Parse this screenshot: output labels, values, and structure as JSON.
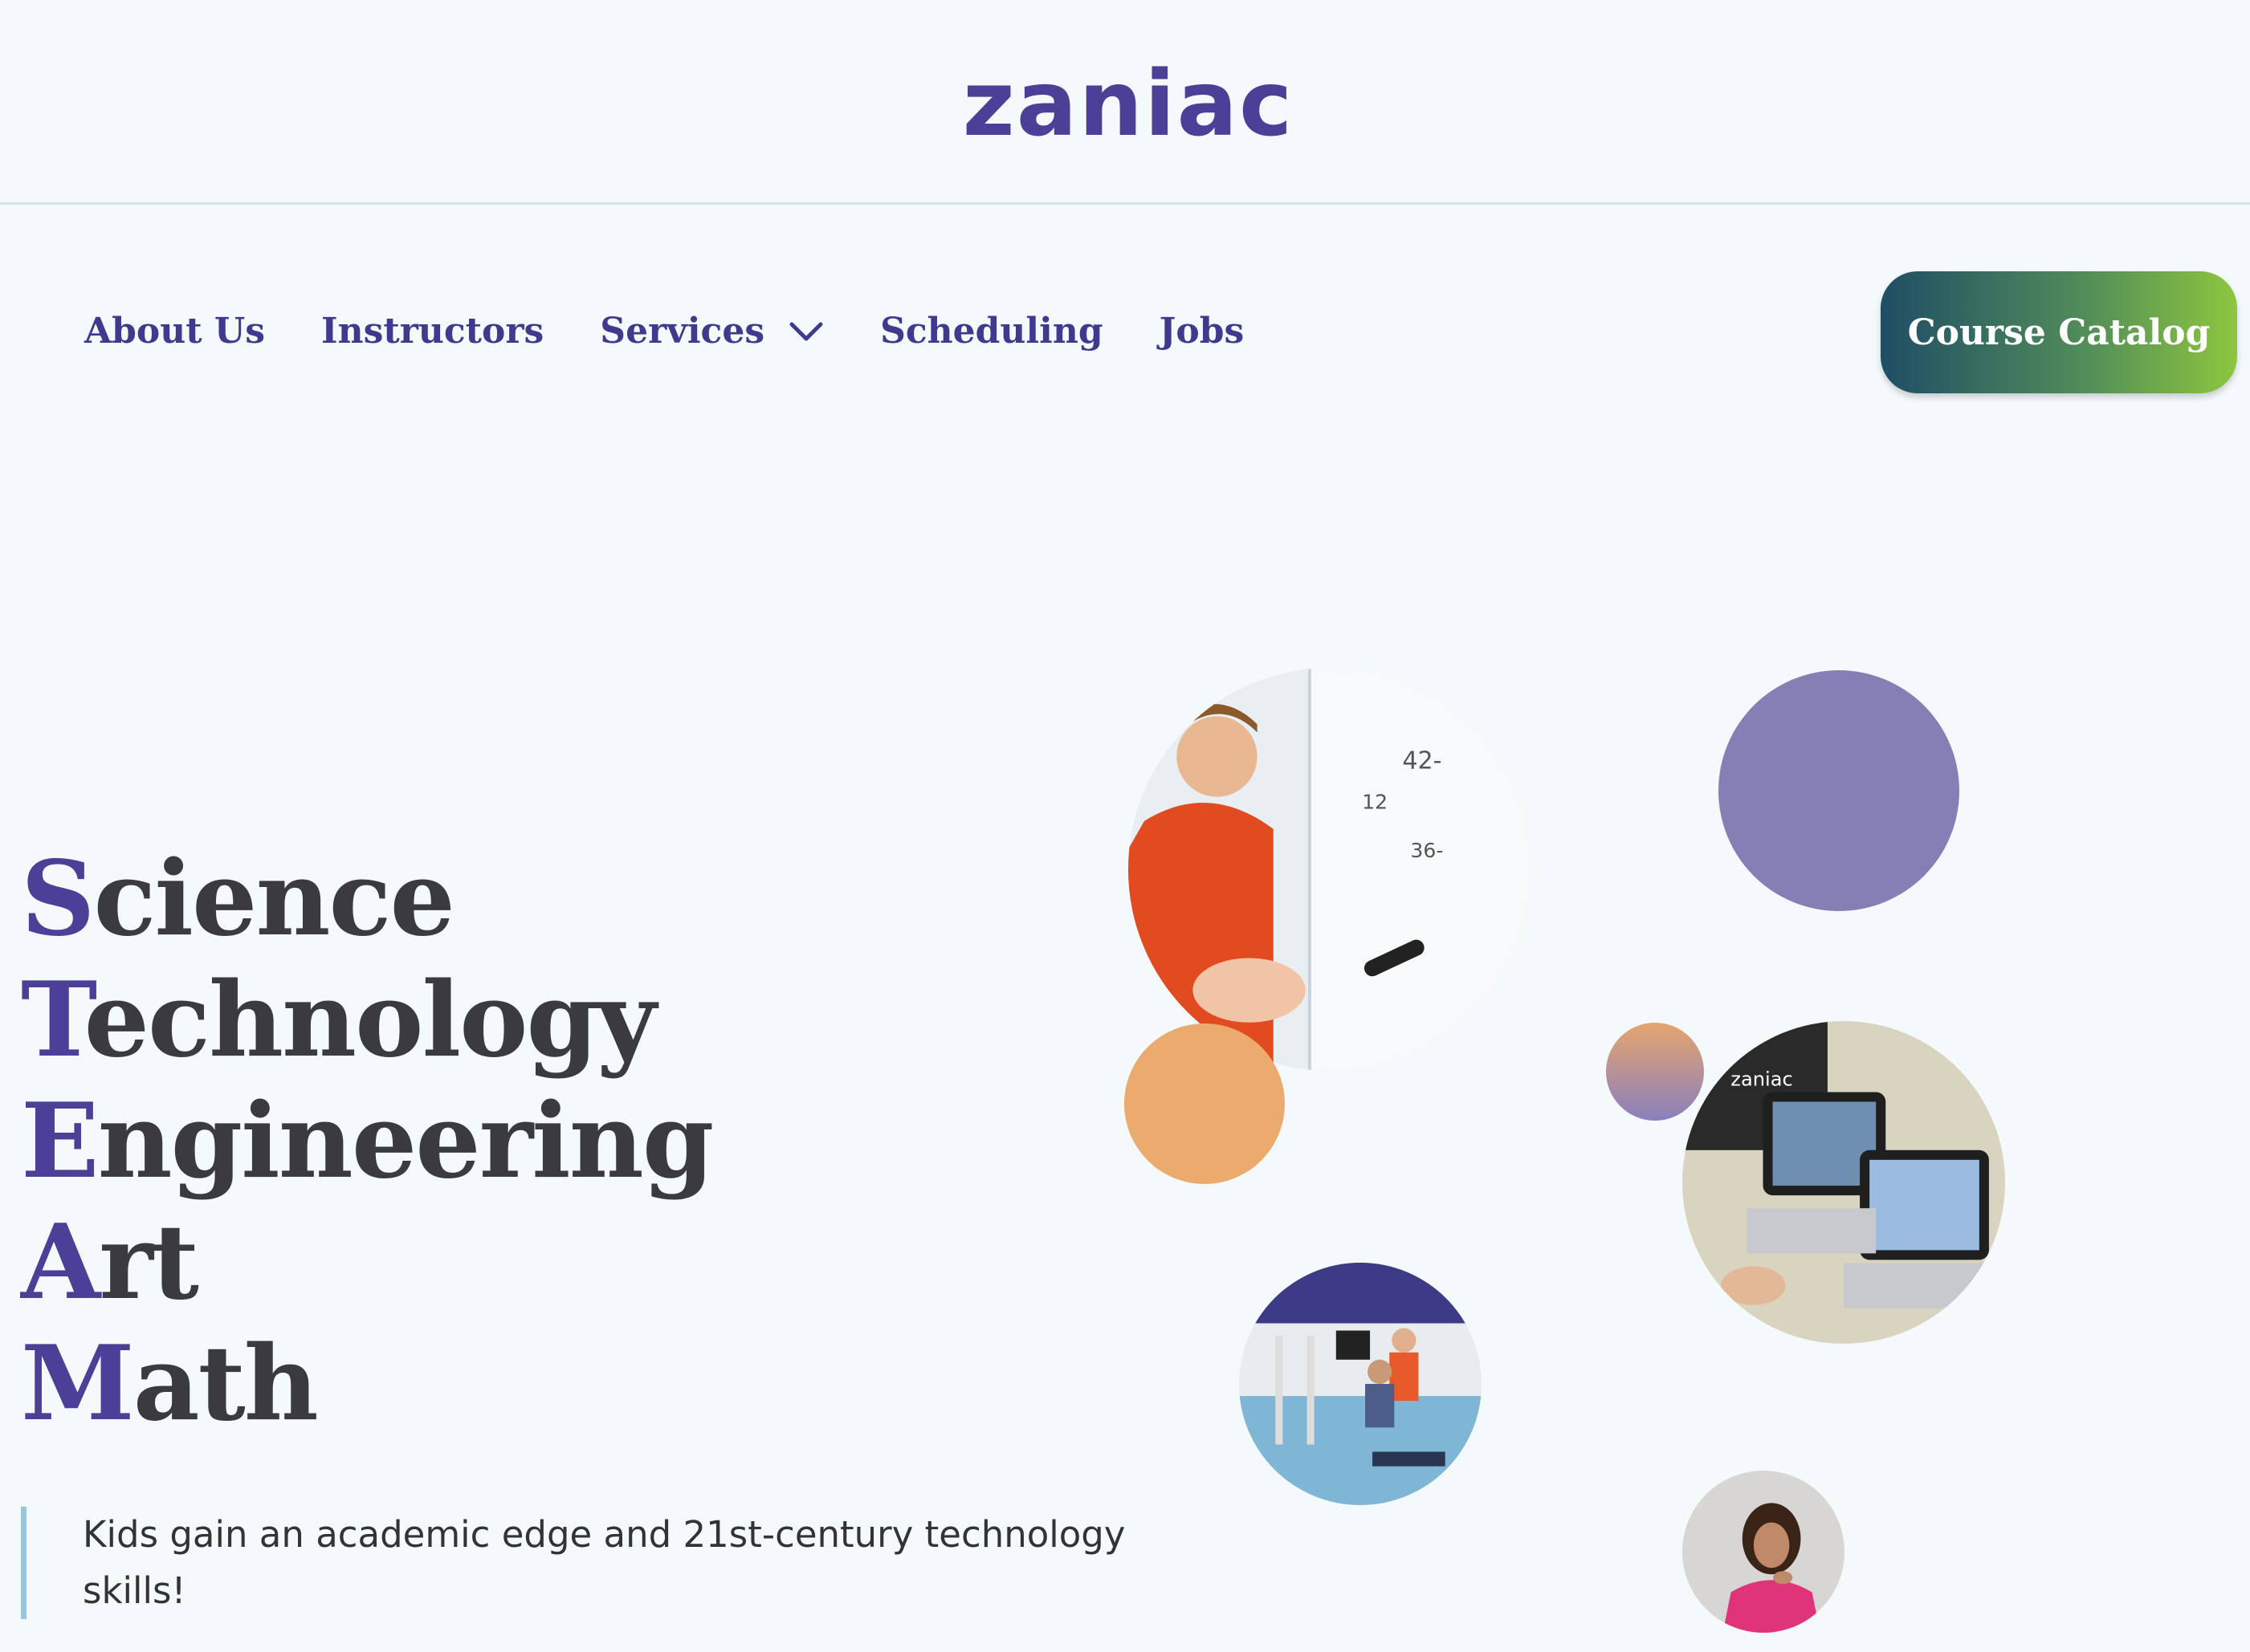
{
  "header": {
    "logo_text": "zaniac",
    "logo_colors": {
      "primary": "#4b3f97"
    }
  },
  "nav": {
    "items": [
      {
        "label": "About Us"
      },
      {
        "label": "Instructors"
      },
      {
        "label": "Services",
        "has_dropdown": true,
        "icon": "chevron-down-icon"
      },
      {
        "label": "Scheduling"
      },
      {
        "label": "Jobs"
      }
    ],
    "cta_label": "Course Catalog"
  },
  "hero": {
    "stem_lines": [
      {
        "initial": "S",
        "rest": "cience"
      },
      {
        "initial": "T",
        "rest": "echnology"
      },
      {
        "initial": "E",
        "rest": "ngineering"
      },
      {
        "initial": "A",
        "rest": "rt"
      },
      {
        "initial": "M",
        "rest": "ath"
      }
    ],
    "tagline": "Kids gain an academic edge and 21st-century technology skills!"
  },
  "colors": {
    "accent_purple": "#4b3f97",
    "heading_dark": "#3b3b3f",
    "nav_text": "#3f3a8e",
    "background": "#f4fafc",
    "circle_purple": "#8480b6",
    "circle_orange": "#ebab6e",
    "cta_gradient_start": "#1f4d66",
    "cta_gradient_end": "#8dc63f"
  }
}
